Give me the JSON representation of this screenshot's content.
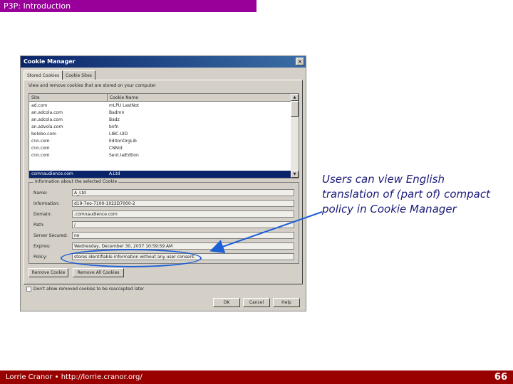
{
  "slide": {
    "header": "P3P: Introduction",
    "footer": "Lorrie Cranor • http://lorrie.cranor.org/",
    "page_number": "66",
    "callout": "Users can view English translation of (part of) compact policy in Cookie Manager",
    "accent_colors": {
      "header_bar": "#990099",
      "footer_bar": "#990000",
      "highlight_ring": "#1e5fd6"
    }
  },
  "cookie_manager": {
    "title": "Cookie Manager",
    "close_glyph": "×",
    "tabs": [
      "Stored Cookies",
      "Cookie Sites"
    ],
    "intro": "View and remove cookies that are stored on your computer",
    "columns": [
      "Site",
      "Cookie Name"
    ],
    "rows": [
      [
        "ad.com",
        "mLPU LastNot"
      ],
      [
        "an.adcola.com",
        "Badmn"
      ],
      [
        "an.adcola.com",
        "Badz"
      ],
      [
        "an.advola.com",
        "bnfn"
      ],
      [
        "bolobo.com",
        "LIBC-UID"
      ],
      [
        "cnn.com",
        "EditonOrgLib"
      ],
      [
        "cnn.com",
        "CNNid"
      ],
      [
        "cnn.com",
        "Sent.IaiEdtion"
      ],
      [
        "comnaudience.com",
        "A.Ltd"
      ]
    ],
    "selected_row": 8,
    "info_group_label": "Information about the selected Cookie",
    "fields": [
      {
        "label": "Name:",
        "value": "A_Ltd"
      },
      {
        "label": "Information:",
        "value": "d19-7eo-7100-1022D7000-2"
      },
      {
        "label": "Domain:",
        "value": ".comnaudience.com"
      },
      {
        "label": "Path:",
        "value": "/"
      },
      {
        "label": "Server Secured:",
        "value": "no"
      },
      {
        "label": "Expires:",
        "value": "Wednesday, December 30, 2037 10:59:59 AM"
      },
      {
        "label": "Policy:",
        "value": "stores identifiable information without any user consent"
      }
    ],
    "remove_cookie_label": "Remove Cookie",
    "remove_all_label": "Remove All Cookies",
    "checkbox_label": "Don't allow removed cookies to be reaccepted later",
    "ok_label": "OK",
    "cancel_label": "Cancel",
    "help_label": "Help",
    "scroll_up_glyph": "▲",
    "scroll_down_glyph": "▼"
  }
}
